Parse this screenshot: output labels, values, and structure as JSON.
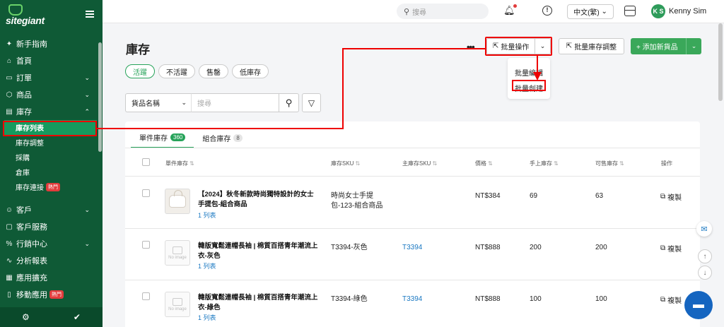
{
  "sidebar": {
    "logo_text": "sitegiant",
    "items": [
      {
        "label": "新手指南",
        "icon": "sparkle-icon"
      },
      {
        "label": "首頁",
        "icon": "home-icon"
      },
      {
        "label": "訂單",
        "icon": "clipboard-icon"
      },
      {
        "label": "商品",
        "icon": "box-icon"
      },
      {
        "label": "庫存",
        "icon": "inventory-icon"
      }
    ],
    "sub_items": [
      {
        "label": "庫存列表",
        "active": true
      },
      {
        "label": "庫存調整"
      },
      {
        "label": "採購"
      },
      {
        "label": "倉庫"
      },
      {
        "label": "庫存連接",
        "badge": "熱門"
      }
    ],
    "items2": [
      {
        "label": "客戶",
        "icon": "users-icon"
      },
      {
        "label": "客戶服務",
        "icon": "chat-icon"
      },
      {
        "label": "行銷中心",
        "icon": "percent-icon"
      },
      {
        "label": "分析報表",
        "icon": "chart-icon"
      },
      {
        "label": "應用擴充",
        "icon": "grid-icon"
      },
      {
        "label": "移動應用",
        "icon": "phone-icon",
        "badge": "熱門"
      }
    ]
  },
  "topbar": {
    "search_placeholder": "搜尋",
    "language": "中文(繁)",
    "avatar_initials": "K S",
    "username": "Kenny Sim"
  },
  "main": {
    "title": "庫存",
    "filters": [
      "活躍",
      "不活躍",
      "售罄",
      "低庫存"
    ],
    "search_field": "貨品名稱",
    "search_placeholder": "搜尋",
    "more": "•••",
    "bulk_action": "批量操作",
    "bulk_adjust": "批量庫存調整",
    "add_new": "+ 添加新貨品",
    "dropdown": [
      "批量編輯",
      "批量創建"
    ]
  },
  "tabs": [
    {
      "label": "單件庫存",
      "count": "360"
    },
    {
      "label": "組合庫存",
      "count": "8"
    }
  ],
  "columns": [
    "單件庫存",
    "庫存SKU",
    "主庫存SKU",
    "價格",
    "手上庫存",
    "可售庫存",
    "操作"
  ],
  "rows": [
    {
      "name_line1": "【2024】秋冬新款時尚獨特設計的女士",
      "name_line2": "手提包-組合商品",
      "list": "1 列表",
      "sku_line1": "時尚女士手提",
      "sku_line2": "包-123-組合商品",
      "master_sku": "",
      "price": "NT$384",
      "on_hand": "69",
      "available": "63",
      "action": "複製",
      "thumb": "bag"
    },
    {
      "name_line1": "韓版寬鬆連帽長袖 | 棉質百搭青年潮流上",
      "name_line2": "衣-灰色",
      "list": "1 列表",
      "sku_line1": "T3394-灰色",
      "sku_line2": "",
      "master_sku": "T3394",
      "price": "NT$888",
      "on_hand": "200",
      "available": "200",
      "action": "複製",
      "thumb": "no-image"
    },
    {
      "name_line1": "韓版寬鬆連帽長袖 | 棉質百搭青年潮流上",
      "name_line2": "衣-綠色",
      "list": "1 列表",
      "sku_line1": "T3394-綠色",
      "sku_line2": "",
      "master_sku": "T3394",
      "price": "NT$888",
      "on_hand": "100",
      "available": "100",
      "action": "複製",
      "thumb": "no-image"
    }
  ],
  "no_image_text": "No image",
  "colors": {
    "sidebar": "#0f5a36",
    "accent": "#27a35a",
    "annotation": "#e00000",
    "link": "#1a78c2"
  }
}
